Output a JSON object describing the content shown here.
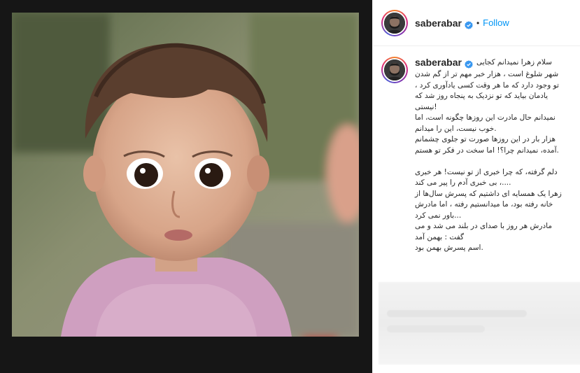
{
  "header": {
    "username": "saberabar",
    "separator": "•",
    "follow_label": "Follow",
    "verified_icon": "verified-badge-icon"
  },
  "caption": {
    "username": "saberabar",
    "first_line": "سلام زهرا نمیدانم کجایی",
    "lines": [
      "شهر شلوغ است ، هزار خبر مهم تر از گم شدن",
      "تو وجود دارد که ما هر وقت کسی یادآوری کرد ،",
      "یادمان بیاید که تو نزدیک به پنجاه روز شد که",
      "!نیستی",
      "نمیدانم حال مادرت این روزها چگونه است، اما",
      ".خوب نیست، این را میدانم",
      "هزار بار در این روزها صورت تو جلوی چشمانم",
      ".آمده، نمیدانم چرا؟! اما سخت در فکر تو هستم",
      "",
      "دلم گرفته، که چرا خبری از تو نیست! هر خبری",
      "....، بی خبری آدم را پیر می کند",
      "زهرا یک همسایه ای داشتیم که پسرش سال‌ها از",
      "خانه رفته بود، ما میدانستیم رفته ، اما مادرش",
      "...باور نمی کرد",
      "مادرش هر روز با صدای در بلند می شد و می",
      "گفت : بهمن آمد",
      ".اسم پسرش بهمن بود"
    ]
  },
  "colors": {
    "accent": "#0095f6",
    "text": "#262626",
    "media_bg": "#161616",
    "verified": "#3897f0"
  }
}
